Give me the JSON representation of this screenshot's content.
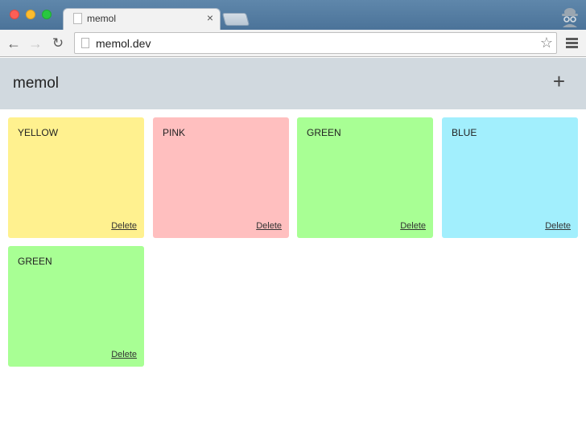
{
  "browser": {
    "tab_title": "memol",
    "tab_close": "×",
    "url": "memol.dev",
    "back": "←",
    "forward": "→",
    "reload": "↻",
    "star": "☆"
  },
  "app": {
    "title": "memol",
    "add_label": "+"
  },
  "notes": [
    {
      "text": "YELLOW",
      "delete_label": "Delete",
      "color": "#fff18f"
    },
    {
      "text": "PINK",
      "delete_label": "Delete",
      "color": "#ffbfbf"
    },
    {
      "text": "GREEN",
      "delete_label": "Delete",
      "color": "#a8ff94"
    },
    {
      "text": "BLUE",
      "delete_label": "Delete",
      "color": "#a2effd"
    },
    {
      "text": "GREEN",
      "delete_label": "Delete",
      "color": "#a8ff94"
    }
  ]
}
